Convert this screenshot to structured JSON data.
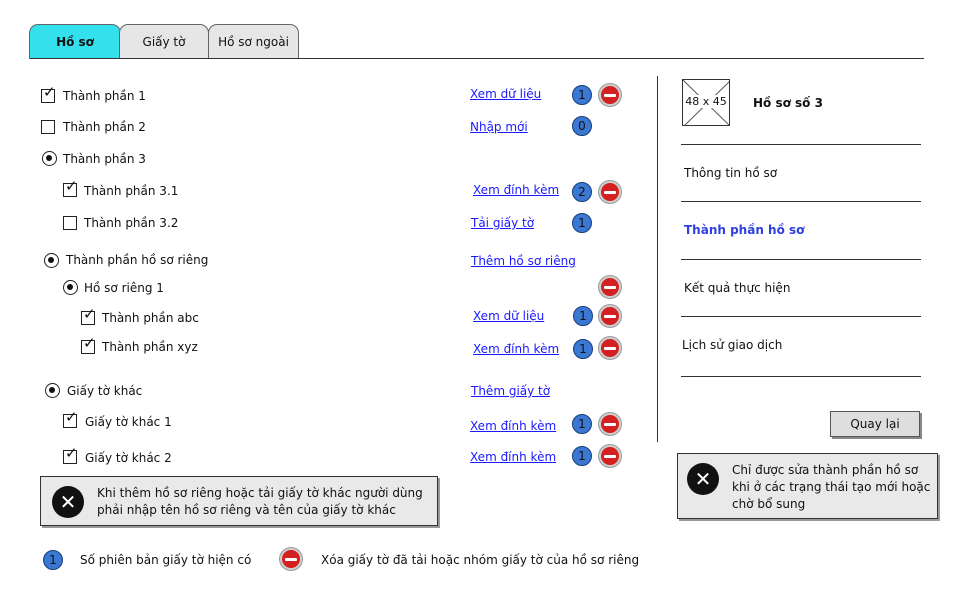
{
  "tabs": [
    {
      "label": "Hồ sơ"
    },
    {
      "label": "Giấy tờ"
    },
    {
      "label": "Hồ sơ ngoài"
    }
  ],
  "items": {
    "tp1": {
      "label": "Thành phần 1",
      "link": "Xem dữ liệu",
      "count": "1",
      "checked": true
    },
    "tp2": {
      "label": "Thành phần 2",
      "link": "Nhập mới",
      "count": "0",
      "checked": false
    },
    "tp3": {
      "label": "Thành phần 3"
    },
    "tp31": {
      "label": "Thành phần 3.1",
      "link": "Xem đính kèm",
      "count": "2",
      "checked": true
    },
    "tp32": {
      "label": "Thành phần 3.2",
      "link": "Tải giấy tờ",
      "count": "1",
      "checked": false
    },
    "rieng": {
      "label": "Thành phần hồ sơ riêng",
      "link": "Thêm hồ sơ riêng"
    },
    "rieng1": {
      "label": "Hồ sơ riêng 1"
    },
    "abc": {
      "label": "Thành phần abc",
      "link": "Xem dữ liệu",
      "count": "1",
      "checked": true
    },
    "xyz": {
      "label": "Thành phần xyz",
      "link": "Xem đính kèm",
      "count": "1",
      "checked": true
    },
    "khac": {
      "label": "Giấy tờ khác",
      "link": "Thêm giấy tờ"
    },
    "khac1": {
      "label": "Giấy tờ khác 1",
      "link": "Xem đính kèm",
      "count": "1",
      "checked": true
    },
    "khac2": {
      "label": "Giấy tờ khác 2",
      "link": "Xem đính kèm",
      "count": "1",
      "checked": true
    }
  },
  "notes": {
    "left": "Khi thêm hồ sơ riêng hoặc tải giấy tờ khác người dùng phải nhập tên hồ sơ riêng và tên của giấy tờ khác",
    "right": "Chỉ được sửa thành phần hồ sơ khi ở các trạng thái tạo mới hoặc chờ bổ sung"
  },
  "legend": {
    "badge_value": "1",
    "badge_text": "Số phiên bản giấy tờ hiện có",
    "remove_text": "Xóa giấy tờ đã tải hoặc nhóm giấy tờ của hồ sơ riêng"
  },
  "right_panel": {
    "image_placeholder": "48 x 45",
    "title": "Hồ sơ số 3",
    "menu": [
      {
        "label": "Thông tin hồ sơ",
        "active": false
      },
      {
        "label": "Thành phần hồ sơ",
        "active": true
      },
      {
        "label": "Kết quả thực hiện",
        "active": false
      },
      {
        "label": "Lịch sử giao dịch",
        "active": false
      }
    ],
    "back_button": "Quay lại"
  },
  "colors": {
    "active_tab": "#33e0ec",
    "link": "#1a1aff",
    "badge": "#3a78d4",
    "remove": "#d32020",
    "active_menu": "#2f3fe0"
  },
  "icons": {
    "remove": "minus-circle-icon",
    "error": "x-circle-icon",
    "placeholder": "image-placeholder-icon"
  }
}
